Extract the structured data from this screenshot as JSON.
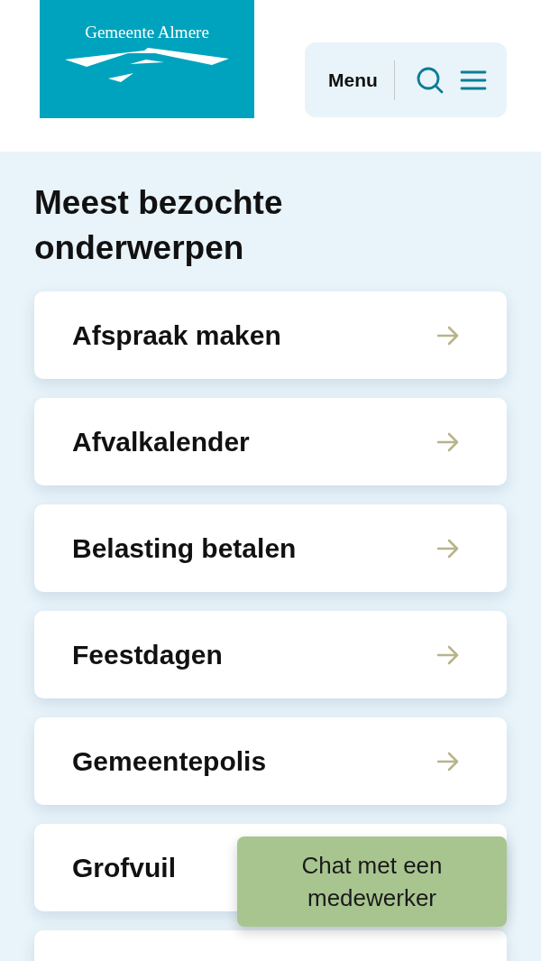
{
  "header": {
    "logo_text": "Gemeente Almere",
    "menu_label": "Menu"
  },
  "section": {
    "title": "Meest bezochte onderwerpen",
    "items": [
      {
        "label": "Afspraak maken",
        "arrow": true
      },
      {
        "label": "Afvalkalender",
        "arrow": true
      },
      {
        "label": "Belasting betalen",
        "arrow": true
      },
      {
        "label": "Feestdagen",
        "arrow": true
      },
      {
        "label": "Gemeentepolis",
        "arrow": true
      },
      {
        "label": "Grofvuil"
      }
    ]
  },
  "chat_button": {
    "label": "Chat met een medewerker"
  }
}
